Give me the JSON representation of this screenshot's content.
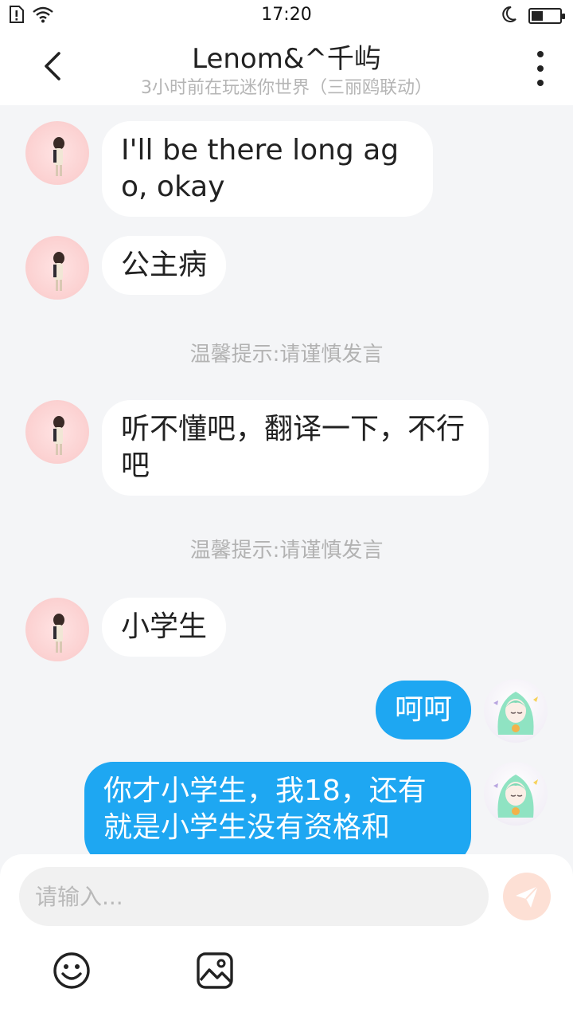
{
  "status_bar": {
    "time": "17:20",
    "icons": [
      "sim-alert-icon",
      "wifi-icon",
      "moon-icon",
      "battery-icon"
    ],
    "battery_level": 0.4
  },
  "header": {
    "title": "Lenom&^千屿",
    "subtitle": "3小时前在玩迷你世界（三丽鸥联动）"
  },
  "messages": [
    {
      "side": "in",
      "text": "I'll be there long ago, okay"
    },
    {
      "side": "in",
      "text": "公主病"
    },
    {
      "type": "tip",
      "text": "温馨提示:请谨慎发言"
    },
    {
      "side": "in",
      "text": "听不懂吧，翻译一下，不行吧"
    },
    {
      "type": "tip",
      "text": "温馨提示:请谨慎发言"
    },
    {
      "side": "in",
      "text": "小学生"
    },
    {
      "side": "out",
      "text": "呵呵"
    },
    {
      "side": "out",
      "text": "你才小学生，我18，还有就是小学生没有资格和"
    }
  ],
  "input": {
    "placeholder": "请输入..."
  },
  "colors": {
    "outgoing_bubble": "#1ea7f2",
    "incoming_bubble": "#ffffff",
    "chat_background": "#f4f5f7",
    "send_button": "#fde0d5"
  }
}
